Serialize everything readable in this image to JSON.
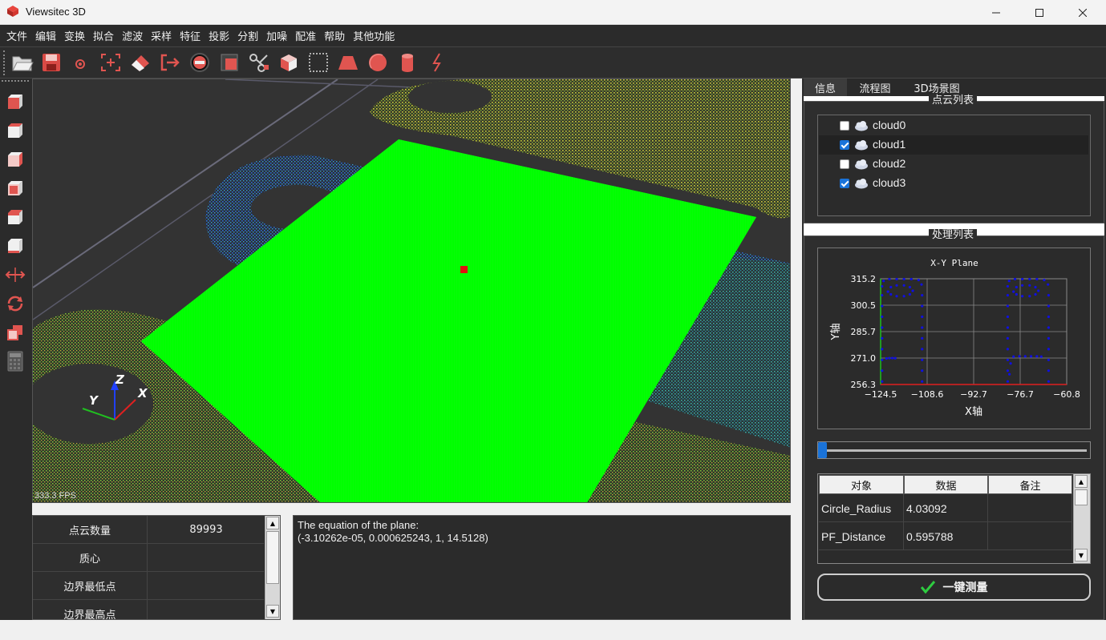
{
  "window": {
    "title": "Viewsitec 3D",
    "minimize": "—",
    "maximize": "☐",
    "close": "✕"
  },
  "menu": [
    "文件",
    "编辑",
    "变换",
    "拟合",
    "滤波",
    "采样",
    "特征",
    "投影",
    "分割",
    "加噪",
    "配准",
    "帮助",
    "其他功能"
  ],
  "toolbar_icons": [
    "open-folder-icon",
    "save-icon",
    "point-icon",
    "pick-point-icon",
    "eraser-icon",
    "exit-icon",
    "minus-circle-icon",
    "box-icon",
    "scissors-icon",
    "cube-icon",
    "bounding-box-icon",
    "trapezoid-icon",
    "sphere-icon",
    "cylinder-icon",
    "lightning-icon"
  ],
  "left_toolbar_icons": [
    "view-front-icon",
    "view-back-icon",
    "view-left-icon",
    "view-right-icon",
    "view-top-icon",
    "view-bottom-icon",
    "translate-icon",
    "rotate-icon",
    "copy-icon",
    "calculator-icon"
  ],
  "viewport": {
    "fps": "333.3 FPS",
    "axes": {
      "x": "X",
      "y": "Y",
      "z": "Z"
    }
  },
  "properties": {
    "rows": [
      {
        "key": "点云数量",
        "value": "89993"
      },
      {
        "key": "质心",
        "value": ""
      },
      {
        "key": "边界最低点",
        "value": ""
      },
      {
        "key": "边界最高点",
        "value": ""
      }
    ]
  },
  "output": {
    "line1": "The equation of the plane:",
    "line2": "(-3.10262e-05, 0.000625243, 1, 14.5128)"
  },
  "right_panel": {
    "tabs": [
      "信息",
      "流程图",
      "3D场景图"
    ],
    "active_tab": "信息",
    "cloud_group_title": "点云列表",
    "clouds": [
      {
        "name": "cloud0",
        "checked": false
      },
      {
        "name": "cloud1",
        "checked": true
      },
      {
        "name": "cloud2",
        "checked": false
      },
      {
        "name": "cloud3",
        "checked": true
      }
    ],
    "process_group_title": "处理列表",
    "slider_value": 0,
    "table": {
      "headers": [
        "对象",
        "数据",
        "备注"
      ],
      "rows": [
        [
          "Circle_Radius",
          "4.03092",
          ""
        ],
        [
          "PF_Distance",
          "0.595788",
          ""
        ]
      ]
    },
    "measure_button": "一键测量"
  },
  "chart_data": {
    "type": "scatter",
    "title": "X-Y Plane",
    "xlabel": "X轴",
    "ylabel": "Y轴",
    "xlim": [
      -124.5,
      -60.8
    ],
    "ylim": [
      256.3,
      315.2
    ],
    "x_ticks": [
      "-124.5",
      "-108.6",
      "-92.7",
      "-76.7",
      "-60.8"
    ],
    "y_ticks": [
      "315.2",
      "300.5",
      "285.7",
      "271.0",
      "256.3"
    ],
    "grid": true,
    "series": [
      {
        "color": "#1010e0",
        "points": [
          [
            -124.0,
            258
          ],
          [
            -124.0,
            264
          ],
          [
            -124.0,
            270
          ],
          [
            -124.0,
            276
          ],
          [
            -124.0,
            282
          ],
          [
            -124.0,
            288
          ],
          [
            -124.0,
            294
          ],
          [
            -124.0,
            300
          ],
          [
            -124.0,
            306
          ],
          [
            -124.0,
            311
          ],
          [
            -123.5,
            314
          ],
          [
            -121.5,
            315
          ],
          [
            -119,
            315
          ],
          [
            -116.5,
            315
          ],
          [
            -114,
            315
          ],
          [
            -111.5,
            314.5
          ],
          [
            -110.5,
            312
          ],
          [
            -110.3,
            306
          ],
          [
            -110.3,
            300
          ],
          [
            -110.3,
            294
          ],
          [
            -110.3,
            288
          ],
          [
            -110.3,
            282
          ],
          [
            -110.3,
            276
          ],
          [
            -110.3,
            270
          ],
          [
            -110.3,
            264
          ],
          [
            -110.3,
            258
          ],
          [
            -122,
            308
          ],
          [
            -121,
            310.5
          ],
          [
            -119,
            311.5
          ],
          [
            -116.5,
            311.5
          ],
          [
            -114.5,
            310.5
          ],
          [
            -113.5,
            308.5
          ],
          [
            -114.5,
            306.5
          ],
          [
            -116.5,
            305.5
          ],
          [
            -119,
            305.5
          ],
          [
            -121,
            306.5
          ],
          [
            -122.5,
            270.8
          ],
          [
            -121.5,
            271
          ],
          [
            -120.5,
            271
          ],
          [
            -119.5,
            270.9
          ],
          [
            -81.0,
            258
          ],
          [
            -81.0,
            264
          ],
          [
            -81.0,
            270
          ],
          [
            -81.0,
            276
          ],
          [
            -81.0,
            282
          ],
          [
            -81.0,
            288
          ],
          [
            -81.0,
            294
          ],
          [
            -81.0,
            300
          ],
          [
            -81.0,
            306
          ],
          [
            -81.0,
            311
          ],
          [
            -80.5,
            314
          ],
          [
            -78.5,
            315
          ],
          [
            -76,
            315
          ],
          [
            -73.5,
            315
          ],
          [
            -71,
            315
          ],
          [
            -68.5,
            314.5
          ],
          [
            -67.2,
            312
          ],
          [
            -67.0,
            306
          ],
          [
            -67.0,
            300
          ],
          [
            -67.0,
            294
          ],
          [
            -67.0,
            288
          ],
          [
            -67.0,
            282
          ],
          [
            -67.0,
            276
          ],
          [
            -67.0,
            270
          ],
          [
            -67.0,
            264
          ],
          [
            -67.0,
            258
          ],
          [
            -79,
            308
          ],
          [
            -78,
            310.5
          ],
          [
            -76,
            311.5
          ],
          [
            -73.5,
            311.5
          ],
          [
            -71.5,
            310.5
          ],
          [
            -70.5,
            308.5
          ],
          [
            -71.5,
            306.5
          ],
          [
            -73.5,
            305.5
          ],
          [
            -76,
            305.5
          ],
          [
            -78,
            306.5
          ],
          [
            -80,
            268
          ],
          [
            -79,
            271.8
          ],
          [
            -77,
            272
          ],
          [
            -75,
            272
          ],
          [
            -73,
            272
          ],
          [
            -71,
            272
          ],
          [
            -69.5,
            271.8
          ],
          [
            -80.4,
            262
          ]
        ]
      }
    ]
  }
}
